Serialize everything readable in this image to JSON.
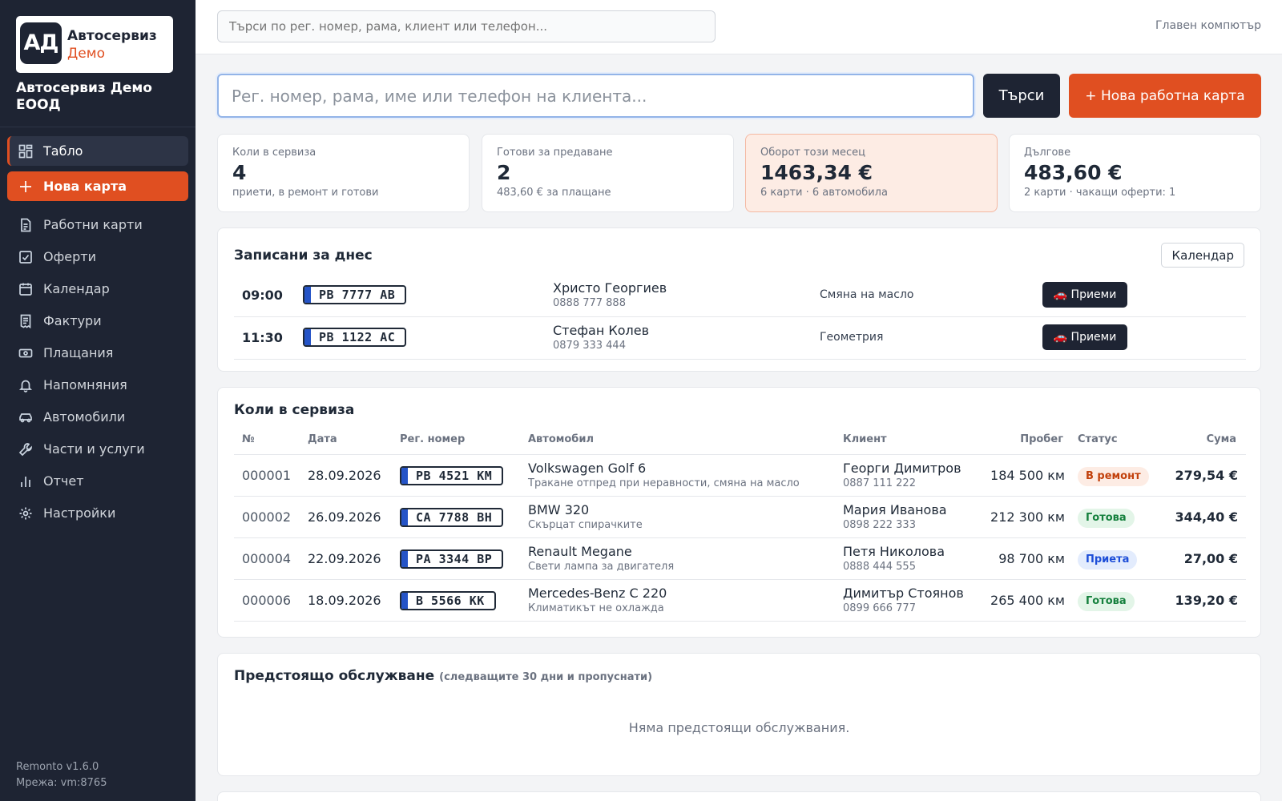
{
  "sidebar": {
    "logo_mark": "АД",
    "logo_line1": "Автосервиз",
    "logo_line2": "Демо",
    "company": "Автосервиз Демо ЕООД",
    "items": [
      {
        "label": "Табло",
        "icon": "dashboard-icon"
      },
      {
        "label": "Нова карта",
        "icon": "plus-icon"
      },
      {
        "label": "Работни карти",
        "icon": "document-icon"
      },
      {
        "label": "Оферти",
        "icon": "checkbox-icon"
      },
      {
        "label": "Календар",
        "icon": "calendar-icon"
      },
      {
        "label": "Фактури",
        "icon": "receipt-icon"
      },
      {
        "label": "Плащания",
        "icon": "money-icon"
      },
      {
        "label": "Напомняния",
        "icon": "bell-icon"
      },
      {
        "label": "Автомобили",
        "icon": "car-icon"
      },
      {
        "label": "Части и услуги",
        "icon": "wrench-icon"
      },
      {
        "label": "Отчет",
        "icon": "bar-chart-icon"
      },
      {
        "label": "Настройки",
        "icon": "gear-icon"
      }
    ],
    "version": "Remonto v1.6.0",
    "network": "Мрежа: vm:8765"
  },
  "topbar": {
    "search_placeholder": "Търси по рег. номер, рама, клиент или телефон...",
    "machine": "Главен компютър"
  },
  "main_search": {
    "placeholder": "Рег. номер, рама, име или телефон на клиента...",
    "search_label": "Търси",
    "new_label": "+ Нова работна карта"
  },
  "stats": [
    {
      "label": "Коли в сервиза",
      "value": "4",
      "sub": "приети, в ремонт и готови"
    },
    {
      "label": "Готови за предаване",
      "value": "2",
      "sub": "483,60 € за плащане"
    },
    {
      "label": "Оборот този месец",
      "value": "1463,34 €",
      "sub": "6 карти · 6 автомобила"
    },
    {
      "label": "Дългове",
      "value": "483,60 €",
      "sub": "2 карти · чакащи оферти: 1"
    }
  ],
  "today": {
    "title": "Записани за днес",
    "calendar_label": "Календар",
    "accept_label": "🚗 Приеми",
    "rows": [
      {
        "time": "09:00",
        "plate": "PB 7777 AB",
        "client": "Христо Георгиев",
        "phone": "0888 777 888",
        "service": "Смяна на масло"
      },
      {
        "time": "11:30",
        "plate": "PB 1122 AC",
        "client": "Стефан Колев",
        "phone": "0879 333 444",
        "service": "Геометрия"
      }
    ]
  },
  "cars": {
    "title": "Коли в сервиза",
    "headers": {
      "num": "№",
      "date": "Дата",
      "plate": "Рег. номер",
      "car": "Автомобил",
      "client": "Клиент",
      "km": "Пробег",
      "status": "Статус",
      "sum": "Сума"
    },
    "rows": [
      {
        "num": "000001",
        "date": "28.09.2026",
        "plate": "PB 4521 KM",
        "car": "Volkswagen Golf 6",
        "desc": "Тракане отпред при неравности, смяна на масло",
        "client": "Георги Димитров",
        "phone": "0887 111 222",
        "km": "184 500 км",
        "status": "В ремонт",
        "sum": "279,54 €"
      },
      {
        "num": "000002",
        "date": "26.09.2026",
        "plate": "CA 7788 BH",
        "car": "BMW 320",
        "desc": "Скърцат спирачките",
        "client": "Мария Иванова",
        "phone": "0898 222 333",
        "km": "212 300 км",
        "status": "Готова",
        "sum": "344,40 €"
      },
      {
        "num": "000004",
        "date": "22.09.2026",
        "plate": "PA 3344 BP",
        "car": "Renault Megane",
        "desc": "Свети лампа за двигателя",
        "client": "Петя Николова",
        "phone": "0888 444 555",
        "km": "98 700 км",
        "status": "Приета",
        "sum": "27,00 €"
      },
      {
        "num": "000006",
        "date": "18.09.2026",
        "plate": "B 5566 KK",
        "car": "Mercedes-Benz C 220",
        "desc": "Климатикът не охлажда",
        "client": "Димитър Стоянов",
        "phone": "0899 666 777",
        "km": "265 400 км",
        "status": "Готова",
        "sum": "139,20 €"
      }
    ]
  },
  "upcoming": {
    "title": "Предстоящо обслужване",
    "subtitle": "(следващите 30 дни и пропуснати)",
    "empty": "Няма предстоящи обслужвания."
  },
  "colors": {
    "accent": "#e04f21",
    "sidebar": "#1e2433",
    "plate_band": "#2554c7"
  }
}
